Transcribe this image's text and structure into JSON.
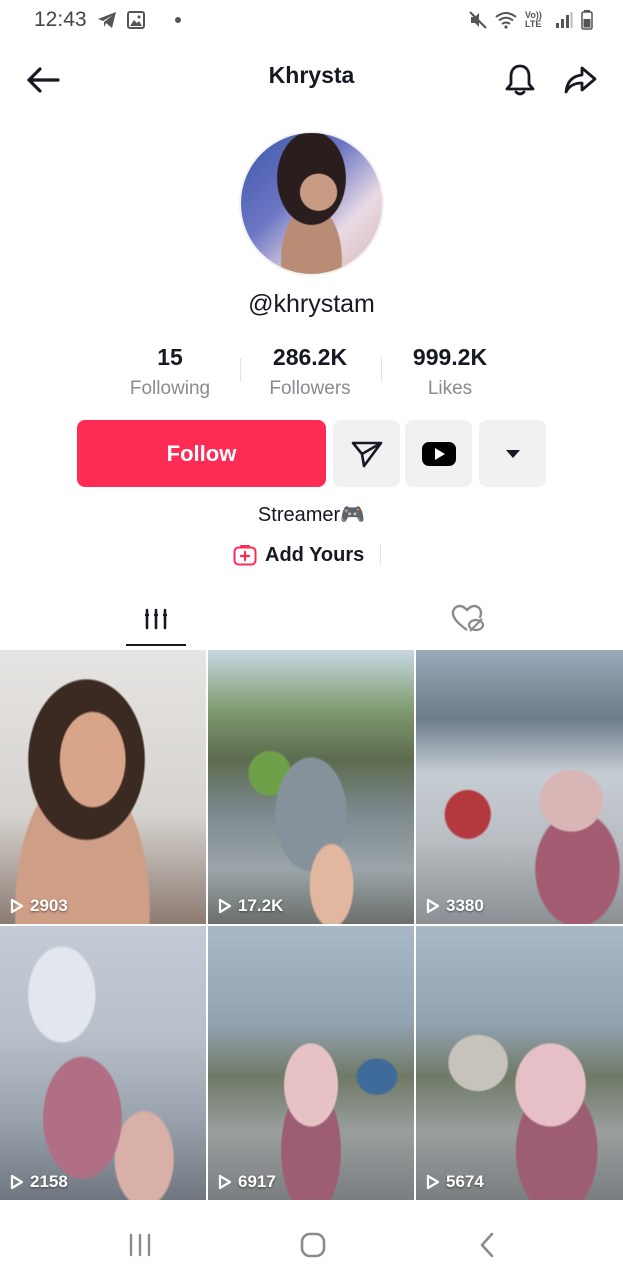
{
  "status_bar": {
    "time": "12:43",
    "left_icons": [
      "telegram-icon",
      "gallery-icon"
    ],
    "right_icons": [
      "mute-icon",
      "wifi-icon",
      "volte-icon",
      "signal-icon",
      "battery-icon"
    ],
    "volte_text": "Vo)) LTE"
  },
  "header": {
    "title": "Khrysta",
    "icons": [
      "back-arrow-icon",
      "bell-icon",
      "share-icon"
    ]
  },
  "profile": {
    "handle": "@khrystam",
    "stats": [
      {
        "value": "15",
        "label": "Following"
      },
      {
        "value": "286.2K",
        "label": "Followers"
      },
      {
        "value": "999.2K",
        "label": "Likes"
      }
    ],
    "follow_label": "Follow",
    "action_icons": [
      "send-message-icon",
      "youtube-icon",
      "dropdown-icon"
    ],
    "bio": "Streamer🎮",
    "add_yours": "Add Yours"
  },
  "tabs": [
    {
      "icon": "videos-grid-icon",
      "active": true
    },
    {
      "icon": "liked-hidden-icon",
      "active": false
    }
  ],
  "videos": [
    {
      "views": "2903"
    },
    {
      "views": "17.2K"
    },
    {
      "views": "3380"
    },
    {
      "views": "2158"
    },
    {
      "views": "6917"
    },
    {
      "views": "5674"
    }
  ],
  "nav_bar": {
    "icons": [
      "recents-icon",
      "home-icon",
      "back-icon"
    ]
  },
  "colors": {
    "accent": "#fe2c55",
    "text": "#161823",
    "muted": "#8a8b91",
    "button_bg": "#f1f1f2"
  }
}
